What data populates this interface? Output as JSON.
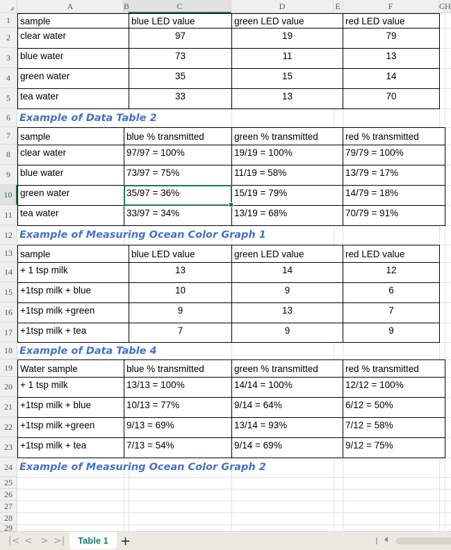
{
  "columns": [
    "A",
    "B",
    "C",
    "D",
    "E",
    "F",
    "G",
    "H"
  ],
  "selected_column": "C",
  "selected_row": "10",
  "row_numbers": [
    "1",
    "2",
    "3",
    "4",
    "5",
    "6",
    "7",
    "8",
    "9",
    "10",
    "11",
    "12",
    "13",
    "14",
    "15",
    "16",
    "17",
    "18",
    "19",
    "20",
    "21",
    "22",
    "23",
    "24",
    "25",
    "26",
    "27",
    "28",
    "29"
  ],
  "table1": {
    "headers": [
      "sample",
      "blue LED value",
      "green LED value",
      "red LED value"
    ],
    "rows": [
      [
        "clear water",
        "97",
        "19",
        "79"
      ],
      [
        "blue water",
        "73",
        "11",
        "13"
      ],
      [
        "green water",
        "35",
        "15",
        "14"
      ],
      [
        "tea water",
        "33",
        "13",
        "70"
      ]
    ]
  },
  "title2": "Example of Data Table 2",
  "table2": {
    "headers": [
      "sample",
      "blue % transmitted",
      "green % transmitted",
      "red % transmitted"
    ],
    "rows": [
      [
        "clear water",
        "97/97 = 100%",
        "19/19 = 100%",
        "79/79 = 100%"
      ],
      [
        "blue water",
        "73/97 = 75%",
        "11/19 = 58%",
        "13/79 = 17%"
      ],
      [
        "green water",
        "35/97 = 36%",
        "15/19 = 79%",
        "14/79 = 18%"
      ],
      [
        "tea water",
        "33/97 = 34%",
        "13/19 = 68%",
        "70/79 = 91%"
      ]
    ]
  },
  "title3": "Example of Measuring Ocean Color Graph 1",
  "table3": {
    "headers": [
      "sample",
      "blue LED value",
      "green LED value",
      "red LED value"
    ],
    "rows": [
      [
        "+ 1 tsp milk",
        "13",
        "14",
        "12"
      ],
      [
        "+1tsp milk + blue",
        "10",
        "9",
        "6"
      ],
      [
        "+1tsp milk +green",
        "9",
        "13",
        "7"
      ],
      [
        "+1tsp milk + tea",
        "7",
        "9",
        "9"
      ]
    ]
  },
  "title4": "Example of Data Table 4",
  "table4": {
    "headers": [
      "Water sample",
      "blue % transmitted",
      "green % transmitted",
      "red % transmitted"
    ],
    "rows": [
      [
        "+ 1 tsp milk",
        "13/13 = 100%",
        "14/14 = 100%",
        "12/12 = 100%"
      ],
      [
        "+1tsp milk + blue",
        "10/13 = 77%",
        "9/14 = 64%",
        "6/12 = 50%"
      ],
      [
        "+1tsp milk +green",
        "9/13 = 69%",
        "13/14 = 93%",
        "7/12 = 58%"
      ],
      [
        "+1tsp milk + tea",
        "7/13 = 54%",
        "9/14 = 69%",
        "9/12 = 75%"
      ]
    ]
  },
  "title5": "Example of Measuring Ocean Color Graph 2",
  "tabbar": {
    "nav_first": "|<",
    "nav_prev": "<",
    "nav_next": ">",
    "nav_last": ">|",
    "sheet_tab": "Table 1",
    "add_sheet": "+"
  },
  "colors": {
    "accent": "#217346",
    "title": "#4472c4",
    "sheet_tab_text": "#1e7a6e"
  }
}
